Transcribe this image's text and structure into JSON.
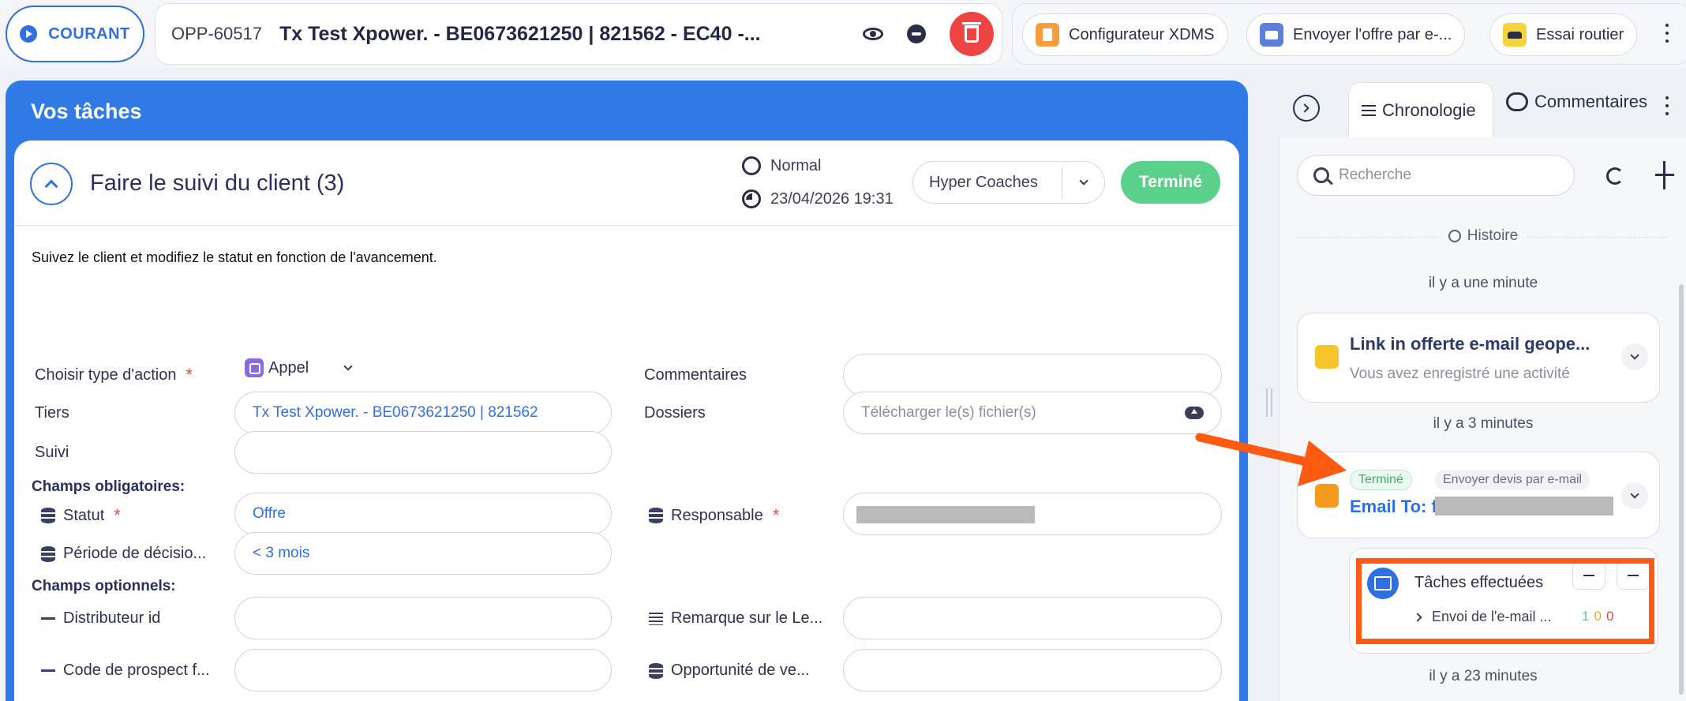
{
  "header": {
    "status_label": "COURANT",
    "opp_id": "OPP-60517",
    "opp_title": "Tx Test Xpower. - BE0673621250 | 821562 - EC40 -...",
    "tools": [
      {
        "label": "Configurateur XDMS",
        "icon": "document-icon",
        "color": "#f59e3b"
      },
      {
        "label": "Envoyer l'offre par e-...",
        "icon": "mail-icon",
        "color": "#5b7fdb"
      },
      {
        "label": "Essai routier",
        "icon": "car-icon",
        "color": "#f6d33a"
      }
    ]
  },
  "task_panel": {
    "title": "Vos tâches",
    "task": {
      "title": "Faire le suivi du client (3)",
      "priority": "Normal",
      "due_date": "23/04/2026 19:31",
      "assignee": "Hyper Coaches",
      "done_label": "Terminé",
      "description": "Suivez le client et modifiez le statut en fonction de l'avancement.",
      "fields": {
        "action_type_label": "Choisir type d'action",
        "action_type_value": "Appel",
        "comments_label": "Commentaires",
        "tiers_label": "Tiers",
        "tiers_value": "Tx Test Xpower. - BE0673621250 | 821562",
        "dossiers_label": "Dossiers",
        "dossiers_placeholder": "Télécharger le(s) fichier(s)",
        "suivi_label": "Suivi",
        "required_section": "Champs obligatoires:",
        "statut_label": "Statut",
        "statut_value": "Offre",
        "responsable_label": "Responsable",
        "periode_label": "Période de décisio...",
        "periode_value": "< 3 mois",
        "optional_section": "Champs optionnels:",
        "distributeur_label": "Distributeur id",
        "remarque_label": "Remarque sur le Le...",
        "code_prospect_label": "Code de prospect f...",
        "opportunite_label": "Opportunité de ve..."
      }
    }
  },
  "right_panel": {
    "tab_active": "Chronologie",
    "tab_inactive": "Commentaires",
    "search_placeholder": "Recherche",
    "history_label": "Histoire",
    "entries": [
      {
        "ago": "il y a une minute",
        "title": "Link in offerte e-mail geope...",
        "subtitle": "Vous avez enregistré une activité"
      },
      {
        "ago": "il y a 3 minutes",
        "status": "Terminé",
        "type": "Envoyer devis par e-mail",
        "title": "Email To: f"
      }
    ],
    "sub_card": {
      "title": "Tâches effectuées",
      "row": "Envoi de l'e-mail ...",
      "counts": [
        "1",
        "0",
        "0"
      ],
      "count_colors": [
        "#5bc98a",
        "#f5a623",
        "#ef4444"
      ]
    },
    "last_ago": "il y a 23 minutes"
  },
  "colors": {
    "accent": "#2f6fe0",
    "success": "#5bd08a",
    "danger": "#ef4444",
    "highlight": "#ff5a12"
  }
}
